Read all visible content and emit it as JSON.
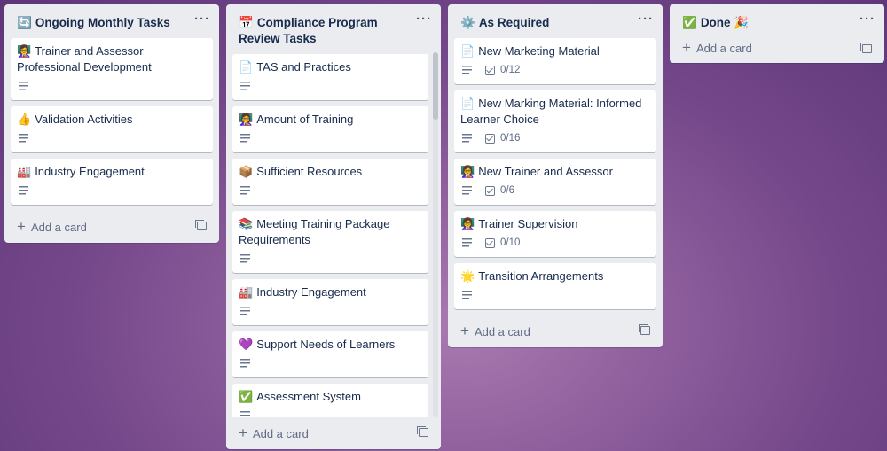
{
  "lists": [
    {
      "emoji": "🔄",
      "title": "Ongoing Monthly Tasks",
      "menu": "···",
      "cards": [
        {
          "emoji": "👩‍🏫",
          "title": "Trainer and Assessor Professional Development"
        },
        {
          "emoji": "👍",
          "title": "Validation Activities"
        },
        {
          "emoji": "🏭",
          "title": "Industry Engagement"
        }
      ],
      "add_label": "Add a card"
    },
    {
      "emoji": "📅",
      "title": "Compliance Program Review Tasks",
      "menu": "···",
      "cards": [
        {
          "emoji": "📄",
          "title": "TAS and Practices"
        },
        {
          "emoji": "👩‍🏫",
          "title": "Amount of Training"
        },
        {
          "emoji": "📦",
          "title": "Sufficient Resources"
        },
        {
          "emoji": "📚",
          "title": "Meeting Training Package Requirements"
        },
        {
          "emoji": "🏭",
          "title": "Industry Engagement"
        },
        {
          "emoji": "💜",
          "title": "Support Needs of Learners"
        },
        {
          "emoji": "✅",
          "title": "Assessment System"
        }
      ],
      "add_label": "Add a card"
    },
    {
      "emoji": "⚙️",
      "title": "As Required",
      "menu": "···",
      "cards": [
        {
          "emoji": "📄",
          "title": "New Marketing Material",
          "checklist": "0/12"
        },
        {
          "emoji": "📄",
          "title": "New Marking Material: Informed Learner Choice",
          "checklist": "0/16"
        },
        {
          "emoji": "👩‍🏫",
          "title": "New Trainer and Assessor",
          "checklist": "0/6"
        },
        {
          "emoji": "👩‍🏫",
          "title": "Trainer Supervision",
          "checklist": "0/10"
        },
        {
          "emoji": "🌟",
          "title": "Transition Arrangements"
        }
      ],
      "add_label": "Add a card"
    },
    {
      "emoji": "✅",
      "title": "Done",
      "title_suffix": "🎉",
      "menu": "···",
      "cards": [],
      "add_label": "Add a card"
    }
  ],
  "icons": {
    "description": "description-icon",
    "checklist": "checklist-icon",
    "add": "plus-icon",
    "template": "card-template-icon",
    "menu": "more-menu-icon"
  }
}
